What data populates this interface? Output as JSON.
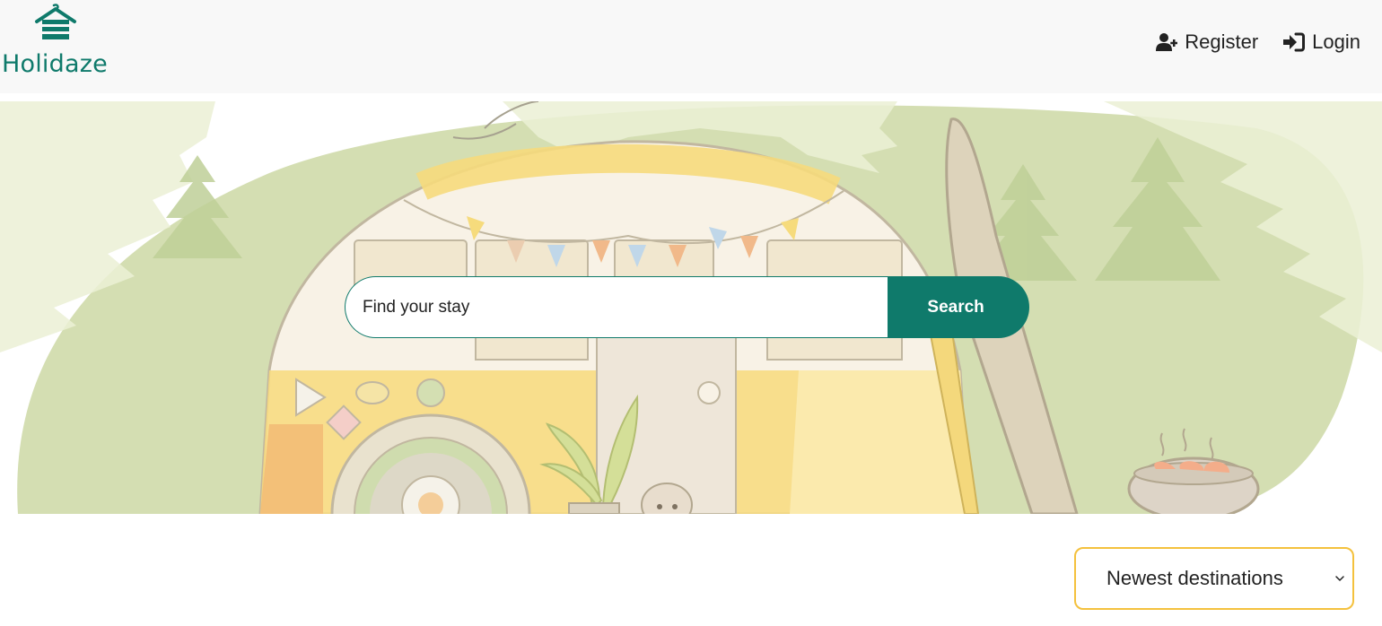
{
  "brand": {
    "name": "Holidaze"
  },
  "nav": {
    "register_label": "Register",
    "login_label": "Login"
  },
  "search": {
    "placeholder": "Find your stay",
    "button_label": "Search"
  },
  "sort": {
    "selected": "Newest destinations"
  },
  "colors": {
    "brand_teal": "#0f7a6b",
    "accent_yellow": "#f4c13d",
    "navbar_bg": "#f8f8f8"
  },
  "icons": {
    "logo": "cabin-icon",
    "register": "user-plus-icon",
    "login": "sign-in-icon",
    "select": "chevron-down-icon"
  }
}
